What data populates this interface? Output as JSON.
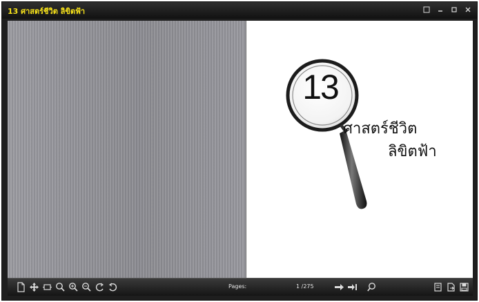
{
  "window": {
    "title": "13 ศาสตร์ชีวิต ลิขิตฟ้า"
  },
  "book": {
    "cover_number": "13",
    "cover_title_line1": "ศาสตร์ชีวิต",
    "cover_title_line2": "ลิขิตฟ้า"
  },
  "toolbar": {
    "pages_label": "Pages:",
    "page_counter": "1 /275"
  },
  "colors": {
    "title": "#f7e21b",
    "toolbar_bg": "#1a1a1a",
    "left_page": "#8f8f95",
    "right_page": "#ffffff"
  },
  "icons": [
    "document-icon",
    "move-icon",
    "fit-width-icon",
    "magnify-icon",
    "zoom-in-icon",
    "zoom-out-icon",
    "rotate-left-icon",
    "rotate-right-icon",
    "next-page-icon",
    "last-page-icon",
    "search-icon",
    "print-icon",
    "export-icon",
    "save-icon"
  ]
}
